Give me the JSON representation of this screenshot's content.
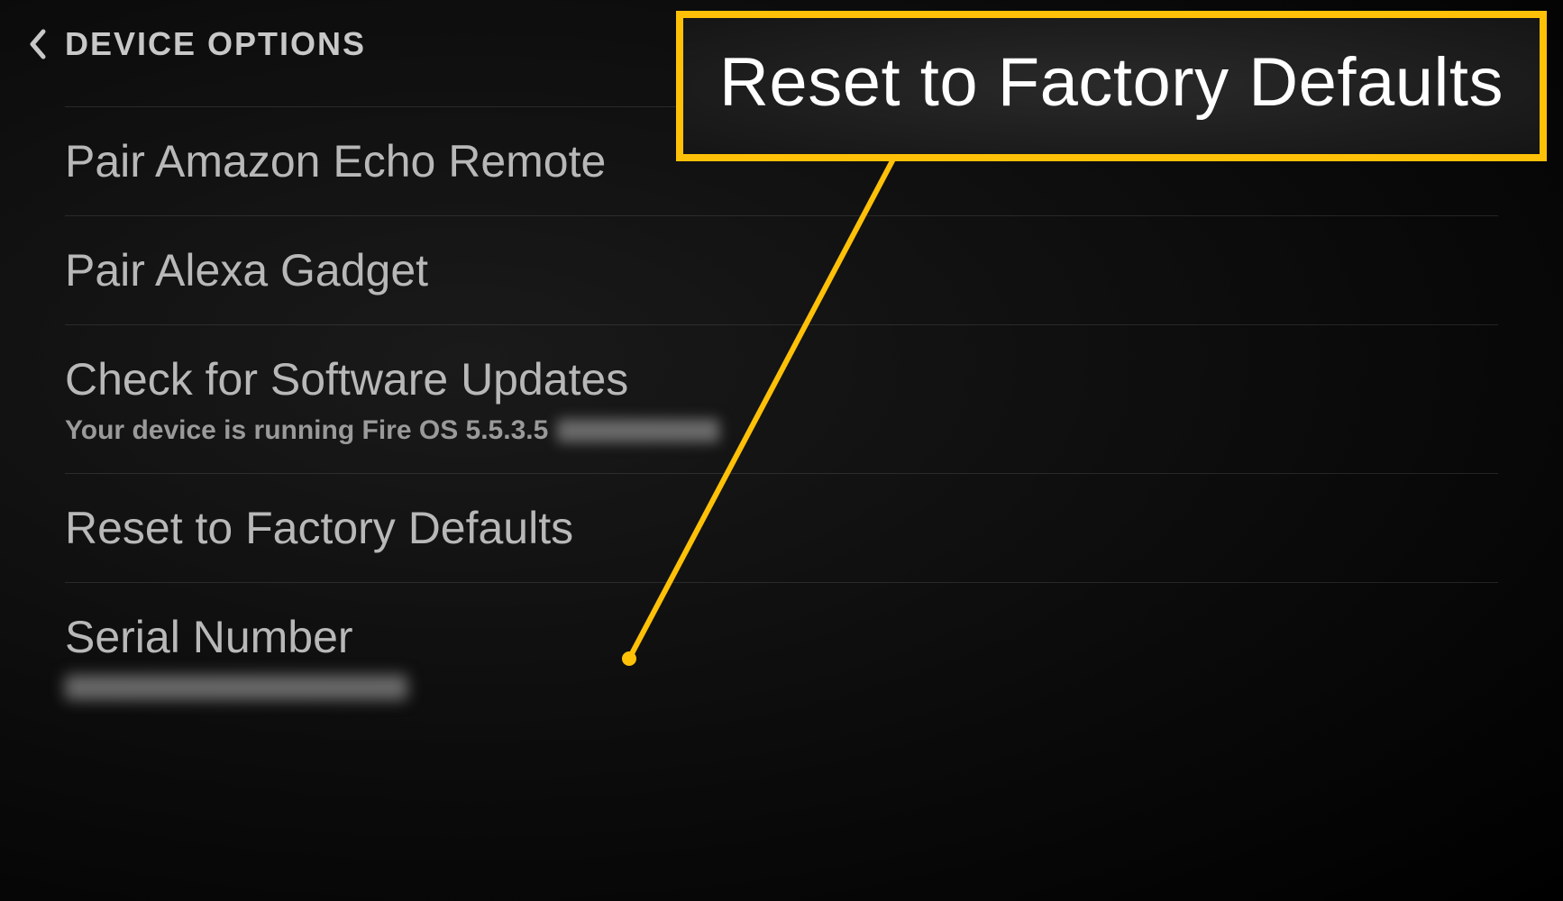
{
  "header": {
    "title": "DEVICE OPTIONS"
  },
  "menu": {
    "items": [
      {
        "label": "Pair Amazon Echo Remote"
      },
      {
        "label": "Pair Alexa Gadget"
      },
      {
        "label": "Check for Software Updates",
        "subtitle": "Your device is running Fire OS 5.5.3.5",
        "hasBlurredSuffix": true
      },
      {
        "label": "Reset to Factory Defaults"
      },
      {
        "label": "Serial Number",
        "hasBlurredSerial": true
      }
    ]
  },
  "callout": {
    "text": "Reset to Factory Defaults"
  },
  "colors": {
    "accent": "#ffc107",
    "text": "#c8c8c8",
    "background": "#0a0a0a"
  }
}
